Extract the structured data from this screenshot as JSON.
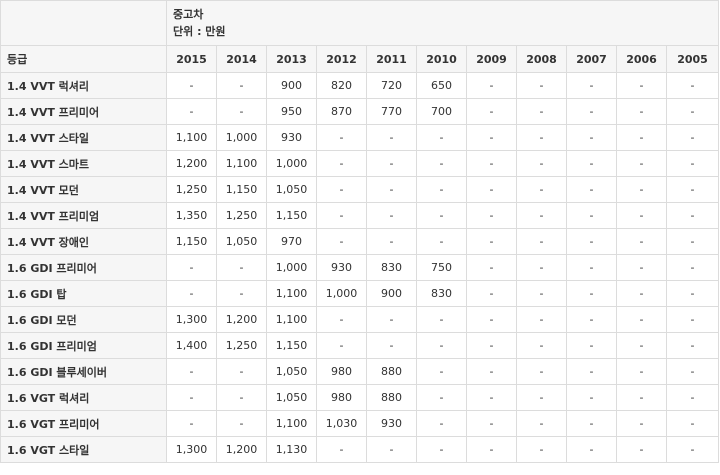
{
  "header": {
    "title": "중고차",
    "unit": "단위 : 만원"
  },
  "columns": {
    "grade_label": "등급",
    "years": [
      "2015",
      "2014",
      "2013",
      "2012",
      "2011",
      "2010",
      "2009",
      "2008",
      "2007",
      "2006",
      "2005"
    ]
  },
  "rows": [
    {
      "grade": "1.4 VVT 럭셔리",
      "values": [
        "-",
        "-",
        "900",
        "820",
        "720",
        "650",
        "-",
        "-",
        "-",
        "-",
        "-"
      ]
    },
    {
      "grade": "1.4 VVT 프리미어",
      "values": [
        "-",
        "-",
        "950",
        "870",
        "770",
        "700",
        "-",
        "-",
        "-",
        "-",
        "-"
      ]
    },
    {
      "grade": "1.4 VVT 스타일",
      "values": [
        "1,100",
        "1,000",
        "930",
        "-",
        "-",
        "-",
        "-",
        "-",
        "-",
        "-",
        "-"
      ]
    },
    {
      "grade": "1.4 VVT 스마트",
      "values": [
        "1,200",
        "1,100",
        "1,000",
        "-",
        "-",
        "-",
        "-",
        "-",
        "-",
        "-",
        "-"
      ]
    },
    {
      "grade": "1.4 VVT 모던",
      "values": [
        "1,250",
        "1,150",
        "1,050",
        "-",
        "-",
        "-",
        "-",
        "-",
        "-",
        "-",
        "-"
      ]
    },
    {
      "grade": "1.4 VVT 프리미엄",
      "values": [
        "1,350",
        "1,250",
        "1,150",
        "-",
        "-",
        "-",
        "-",
        "-",
        "-",
        "-",
        "-"
      ]
    },
    {
      "grade": "1.4 VVT 장애인",
      "values": [
        "1,150",
        "1,050",
        "970",
        "-",
        "-",
        "-",
        "-",
        "-",
        "-",
        "-",
        "-"
      ]
    },
    {
      "grade": "1.6 GDI 프리미어",
      "values": [
        "-",
        "-",
        "1,000",
        "930",
        "830",
        "750",
        "-",
        "-",
        "-",
        "-",
        "-"
      ]
    },
    {
      "grade": "1.6 GDI 탑",
      "values": [
        "-",
        "-",
        "1,100",
        "1,000",
        "900",
        "830",
        "-",
        "-",
        "-",
        "-",
        "-"
      ]
    },
    {
      "grade": "1.6 GDI 모던",
      "values": [
        "1,300",
        "1,200",
        "1,100",
        "-",
        "-",
        "-",
        "-",
        "-",
        "-",
        "-",
        "-"
      ]
    },
    {
      "grade": "1.6 GDI 프리미엄",
      "values": [
        "1,400",
        "1,250",
        "1,150",
        "-",
        "-",
        "-",
        "-",
        "-",
        "-",
        "-",
        "-"
      ]
    },
    {
      "grade": "1.6 GDI 블루세이버",
      "values": [
        "-",
        "-",
        "1,050",
        "980",
        "880",
        "-",
        "-",
        "-",
        "-",
        "-",
        "-"
      ]
    },
    {
      "grade": "1.6 VGT 럭셔리",
      "values": [
        "-",
        "-",
        "1,050",
        "980",
        "880",
        "-",
        "-",
        "-",
        "-",
        "-",
        "-"
      ]
    },
    {
      "grade": "1.6 VGT 프리미어",
      "values": [
        "-",
        "-",
        "1,100",
        "1,030",
        "930",
        "-",
        "-",
        "-",
        "-",
        "-",
        "-"
      ]
    },
    {
      "grade": "1.6 VGT 스타일",
      "values": [
        "1,300",
        "1,200",
        "1,130",
        "-",
        "-",
        "-",
        "-",
        "-",
        "-",
        "-",
        "-"
      ]
    }
  ]
}
